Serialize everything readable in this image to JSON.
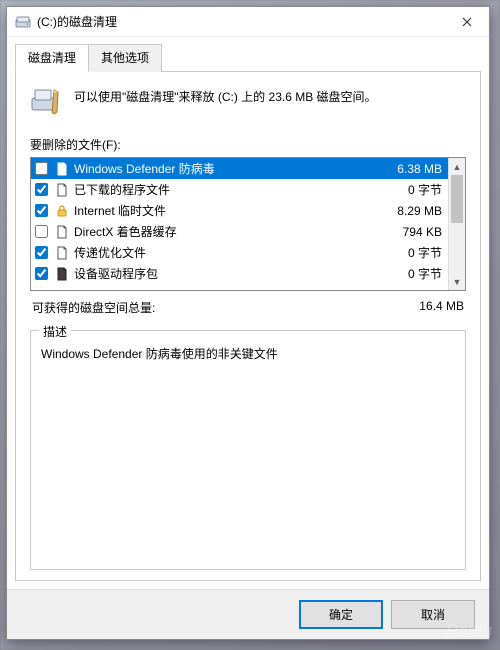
{
  "window": {
    "title": "(C:)的磁盘清理"
  },
  "tabs": {
    "cleanup": "磁盘清理",
    "other": "其他选项"
  },
  "intro": "可以使用\"磁盘清理\"来释放  (C:) 上的 23.6 MB 磁盘空间。",
  "files_label": "要删除的文件(F):",
  "files": [
    {
      "name": "Windows Defender 防病毒",
      "size": "6.38 MB",
      "checked": false,
      "selected": true,
      "icon": "page"
    },
    {
      "name": "已下载的程序文件",
      "size": "0 字节",
      "checked": true,
      "selected": false,
      "icon": "page"
    },
    {
      "name": "Internet 临时文件",
      "size": "8.29 MB",
      "checked": true,
      "selected": false,
      "icon": "lock"
    },
    {
      "name": "DirectX 着色器缓存",
      "size": "794 KB",
      "checked": false,
      "selected": false,
      "icon": "page"
    },
    {
      "name": "传递优化文件",
      "size": "0 字节",
      "checked": true,
      "selected": false,
      "icon": "page"
    },
    {
      "name": "设备驱动程序包",
      "size": "0 字节",
      "checked": true,
      "selected": false,
      "icon": "page-dark"
    }
  ],
  "total": {
    "label": "可获得的磁盘空间总量:",
    "value": "16.4 MB"
  },
  "description": {
    "legend": "描述",
    "text": "Windows Defender 防病毒使用的非关键文件"
  },
  "buttons": {
    "ok": "确定",
    "cancel": "取消"
  }
}
